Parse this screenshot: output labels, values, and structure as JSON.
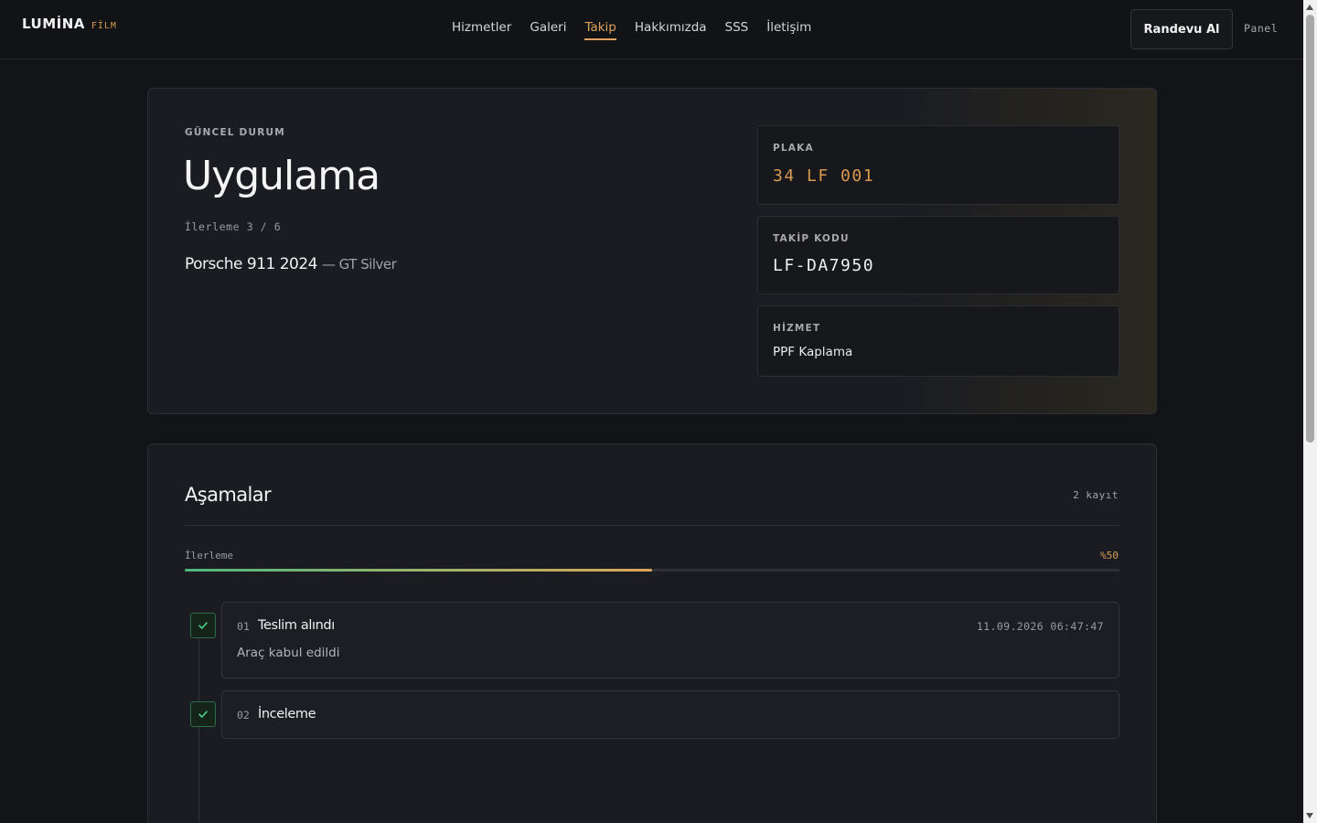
{
  "header": {
    "logo": "LUMİNA",
    "logo_sub": "FİLM",
    "nav": [
      "Hizmetler",
      "Galeri",
      "Takip",
      "Hakkımızda",
      "SSS",
      "İletişim"
    ],
    "active_nav": "Takip",
    "cta_label": "Randevu Al",
    "panel_label": "Panel"
  },
  "status": {
    "eyebrow": "GÜNCEL DURUM",
    "title": "Uygulama",
    "progress_text": "İlerleme 3 / 6",
    "vehicle_model": "Porsche 911 2024",
    "vehicle_color": "— GT Silver",
    "info": [
      {
        "label": "PLAKA",
        "value": "34 LF 001",
        "color": "#d99a4f"
      },
      {
        "label": "TAKİP KODU",
        "value": "LF-DA7950",
        "color": "#f0f0f0"
      },
      {
        "label": "HİZMET",
        "value": "PPF Kaplama",
        "color": "#ececec"
      }
    ]
  },
  "stages": {
    "title": "Aşamalar",
    "count": "2 kayıt",
    "progress_label": "İlerleme",
    "progress_pct_text": "%50",
    "progress_value": 0.5,
    "items": [
      {
        "num": "01",
        "name": "Teslim alındı",
        "date": "11.09.2026 06:47:47",
        "note": "Araç kabul edildi",
        "done": true
      },
      {
        "num": "02",
        "name": "İnceleme",
        "date": "",
        "note": "",
        "done": true
      }
    ]
  },
  "colors": {
    "accent": "#e0a25d",
    "success": "#4fb67c",
    "background": "#131418"
  }
}
